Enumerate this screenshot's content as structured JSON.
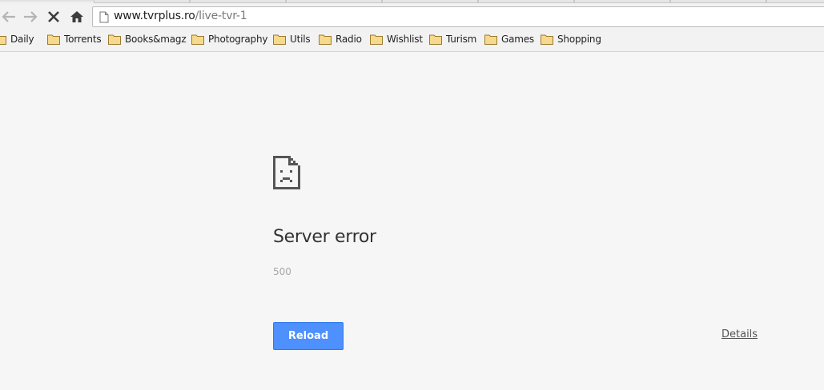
{
  "toolbar": {
    "back_icon": "back-arrow-icon",
    "forward_icon": "forward-arrow-icon",
    "stop_icon": "stop-x-icon",
    "home_icon": "home-icon"
  },
  "omnibox": {
    "url_host": "www.tvrplus.ro",
    "url_path": "/live-tvr-1",
    "page_icon": "page-icon"
  },
  "bookmarks": {
    "folder_icon": "folder-icon",
    "items": [
      {
        "label": "Daily"
      },
      {
        "label": "Torrents"
      },
      {
        "label": "Books&magz"
      },
      {
        "label": "Photography"
      },
      {
        "label": "Utils"
      },
      {
        "label": "Radio"
      },
      {
        "label": "Wishlist"
      },
      {
        "label": "Turism"
      },
      {
        "label": "Games"
      },
      {
        "label": "Shopping"
      }
    ]
  },
  "error_page": {
    "icon": "sad-page-icon",
    "title": "Server error",
    "code": "500",
    "reload_label": "Reload",
    "details_label": "Details"
  },
  "colors": {
    "reload_button": "#4d90fe",
    "page_background": "#f6f6f6"
  }
}
